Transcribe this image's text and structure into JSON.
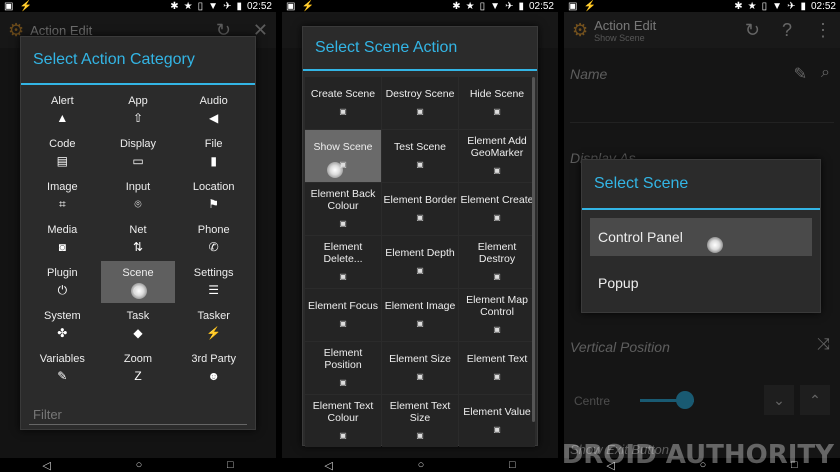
{
  "status_time": "02:52",
  "appbar": {
    "title": "Action Edit",
    "subtitle": "Show Scene"
  },
  "panel1": {
    "dialog_title": "Select Action Category",
    "categories": [
      {
        "label": "Alert",
        "icon": "warning-icon"
      },
      {
        "label": "App",
        "icon": "rocket-icon"
      },
      {
        "label": "Audio",
        "icon": "speaker-icon"
      },
      {
        "label": "Code",
        "icon": "document-icon"
      },
      {
        "label": "Display",
        "icon": "monitor-icon"
      },
      {
        "label": "File",
        "icon": "file-icon"
      },
      {
        "label": "Image",
        "icon": "crop-icon"
      },
      {
        "label": "Input",
        "icon": "mouse-icon"
      },
      {
        "label": "Location",
        "icon": "flag-icon"
      },
      {
        "label": "Media",
        "icon": "camera-icon"
      },
      {
        "label": "Net",
        "icon": "network-arrows-icon"
      },
      {
        "label": "Phone",
        "icon": "phone-icon"
      },
      {
        "label": "Plugin",
        "icon": "plug-icon"
      },
      {
        "label": "Scene",
        "icon": "scene-icon",
        "selected": true
      },
      {
        "label": "Settings",
        "icon": "sliders-icon"
      },
      {
        "label": "System",
        "icon": "android-icon"
      },
      {
        "label": "Task",
        "icon": "diamond-icon"
      },
      {
        "label": "Tasker",
        "icon": "lightning-icon"
      },
      {
        "label": "Variables",
        "icon": "pencil-icon"
      },
      {
        "label": "Zoom",
        "icon": "zoom-icon"
      },
      {
        "label": "3rd Party",
        "icon": "group-icon"
      }
    ],
    "filter_placeholder": "Filter"
  },
  "panel2": {
    "dialog_title": "Select Scene Action",
    "actions": [
      "Create Scene",
      "Destroy Scene",
      "Hide Scene",
      "Show Scene",
      "Test Scene",
      "Element Add GeoMarker",
      "Element Back Colour",
      "Element Border",
      "Element Create",
      "Element Delete...",
      "Element Depth",
      "Element Destroy",
      "Element Focus",
      "Element Image",
      "Element Map Control",
      "Element Position",
      "Element Size",
      "Element Text",
      "Element Text Colour",
      "Element Text Size",
      "Element Value"
    ],
    "selected_index": 3
  },
  "panel3": {
    "name_label": "Name",
    "display_as_label": "Display As",
    "vertical_position_label": "Vertical Position",
    "vertical_position_value": "Centre",
    "show_exit_label": "Show Exit Button",
    "dialog_title": "Select Scene",
    "options": [
      "Control Panel",
      "Popup"
    ],
    "selected_index": 0
  },
  "watermark": "ANDROID AUTHORITY"
}
